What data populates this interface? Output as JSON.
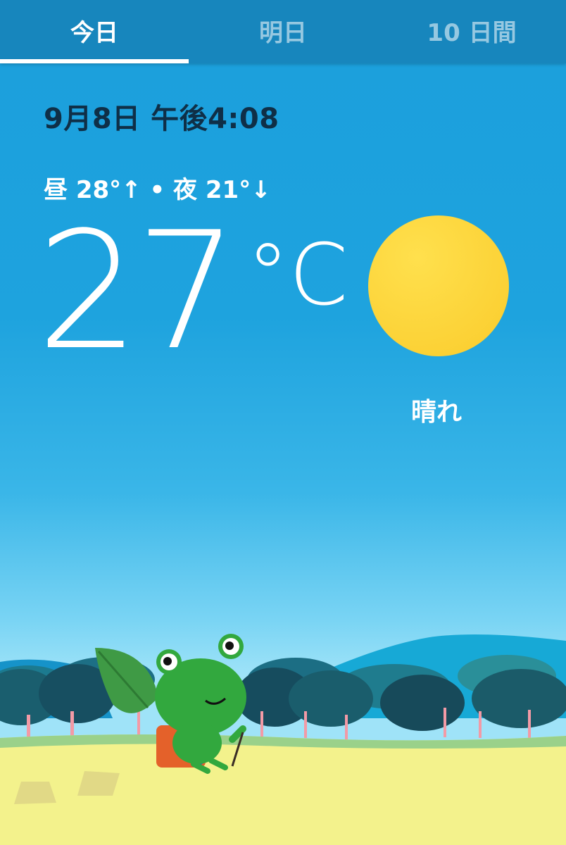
{
  "tabs": [
    {
      "label": "今日",
      "active": true
    },
    {
      "label": "明日",
      "active": false
    },
    {
      "label": "10 日間",
      "active": false
    }
  ],
  "weather": {
    "datetime": "9月8日 午後4:08",
    "high_low": "昼 28°↑ • 夜 21°↓",
    "temperature": "27",
    "unit": "°C",
    "condition": "晴れ",
    "condition_icon": "sun-icon"
  },
  "colors": {
    "tab_bar": "#1786bd",
    "sky": "#1ea3de",
    "sun": "#fdd835",
    "grass": "#f3f28c"
  }
}
